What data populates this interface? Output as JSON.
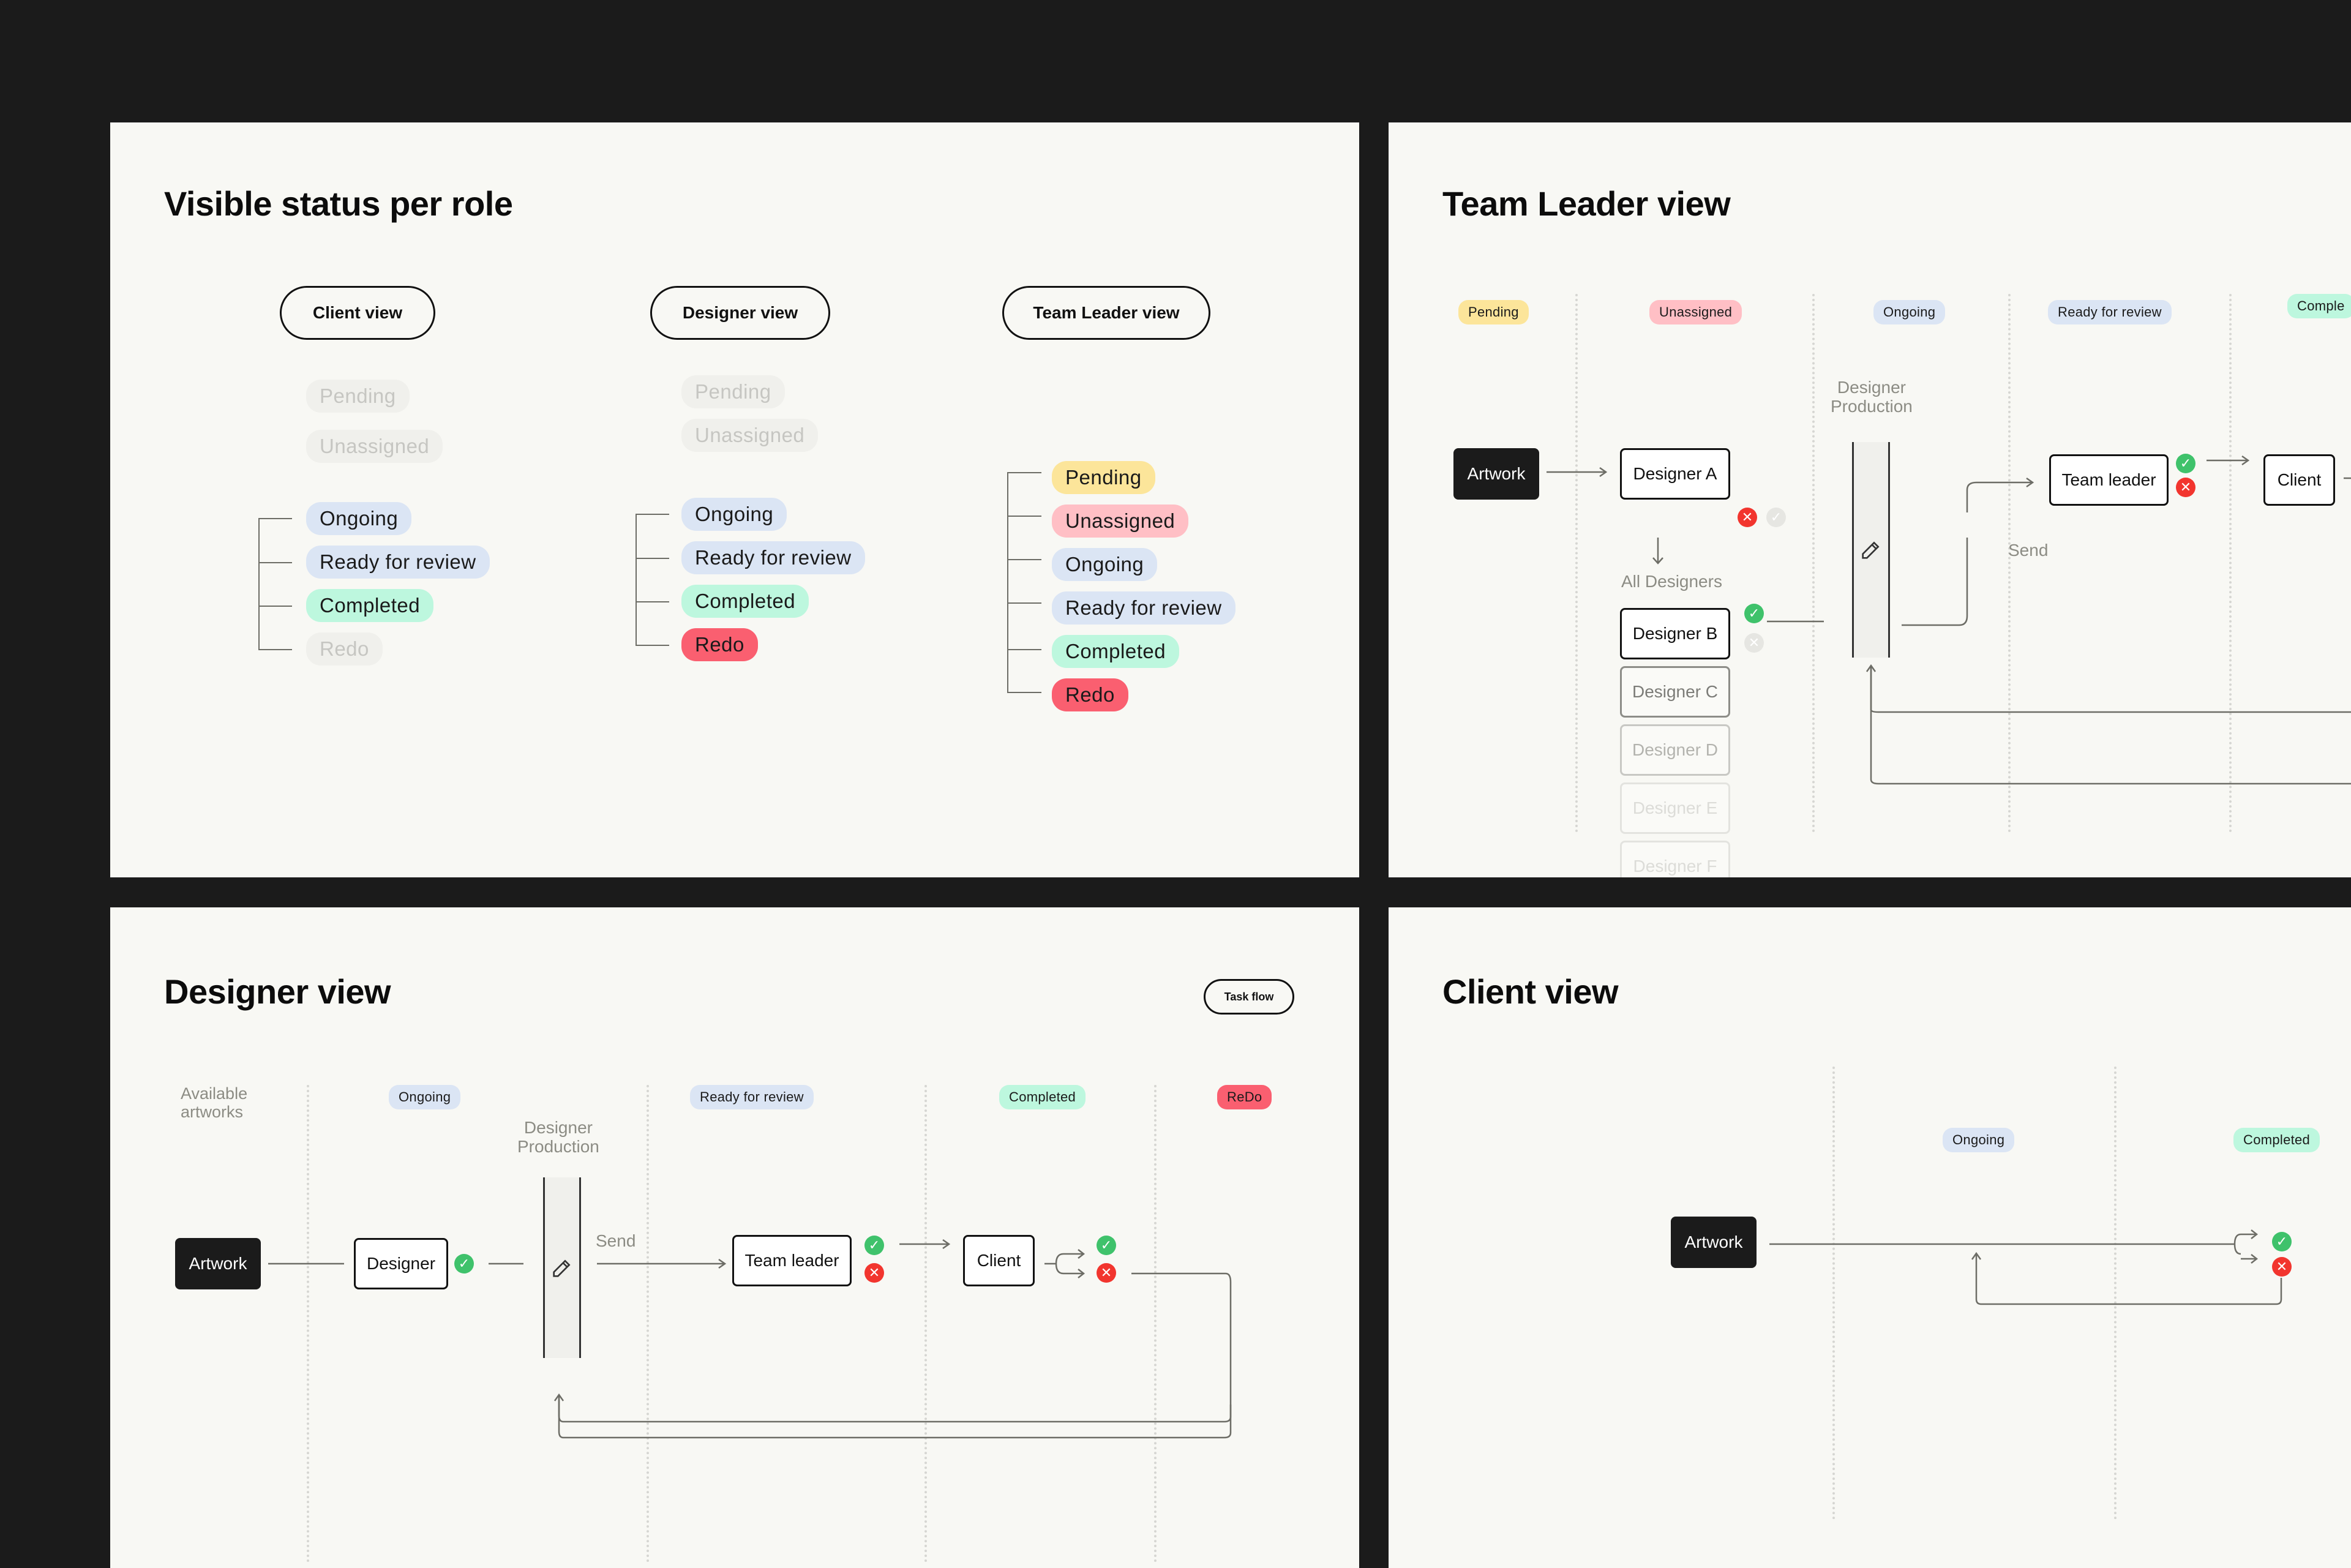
{
  "panels": {
    "status_per_role": {
      "title": "Visible status per role",
      "roles": [
        {
          "label": "Client view",
          "statuses": [
            {
              "label": "Pending",
              "visible": false
            },
            {
              "label": "Unassigned",
              "visible": false
            },
            {
              "label": "Ongoing",
              "visible": true
            },
            {
              "label": "Ready for review",
              "visible": true
            },
            {
              "label": "Completed",
              "visible": true
            },
            {
              "label": "Redo",
              "visible": false
            }
          ]
        },
        {
          "label": "Designer view",
          "statuses": [
            {
              "label": "Pending",
              "visible": false
            },
            {
              "label": "Unassigned",
              "visible": false
            },
            {
              "label": "Ongoing",
              "visible": true
            },
            {
              "label": "Ready for review",
              "visible": true
            },
            {
              "label": "Completed",
              "visible": true
            },
            {
              "label": "Redo",
              "visible": true
            }
          ]
        },
        {
          "label": "Team Leader view",
          "statuses": [
            {
              "label": "Pending",
              "visible": true
            },
            {
              "label": "Unassigned",
              "visible": true
            },
            {
              "label": "Ongoing",
              "visible": true
            },
            {
              "label": "Ready for review",
              "visible": true
            },
            {
              "label": "Completed",
              "visible": true
            },
            {
              "label": "Redo",
              "visible": true
            }
          ]
        }
      ]
    },
    "team_leader": {
      "title": "Team Leader view",
      "columns": [
        "Pending",
        "Unassigned",
        "Ongoing",
        "Ready for review",
        "Comple"
      ],
      "artwork": "Artwork",
      "designers": [
        "Designer A",
        "Designer B",
        "Designer C",
        "Designer D",
        "Designer E",
        "Designer F"
      ],
      "all_designers": "All Designers",
      "production_label": "Designer\nProduction",
      "send": "Send",
      "team_leader": "Team leader",
      "client": "Client"
    },
    "designer": {
      "title": "Designer view",
      "task_flow_button": "Task flow",
      "available_label": "Available\nartworks",
      "columns": [
        "Ongoing",
        "Ready for review",
        "Completed",
        "ReDo"
      ],
      "artwork": "Artwork",
      "designer": "Designer",
      "production_label": "Designer\nProduction",
      "send": "Send",
      "team_leader": "Team leader",
      "client": "Client"
    },
    "client": {
      "title": "Client view",
      "columns": [
        "Ongoing",
        "Completed"
      ],
      "artwork": "Artwork"
    }
  },
  "colors": {
    "pending": "#fce59a",
    "unassigned": "#ffbfc5",
    "ongoing": "#dbe5f4",
    "ready_for_review": "#dbe5f4",
    "completed": "#bdf7de",
    "redo": "#fa5f70",
    "approve": "#3fc26b",
    "reject": "#f2352e"
  }
}
